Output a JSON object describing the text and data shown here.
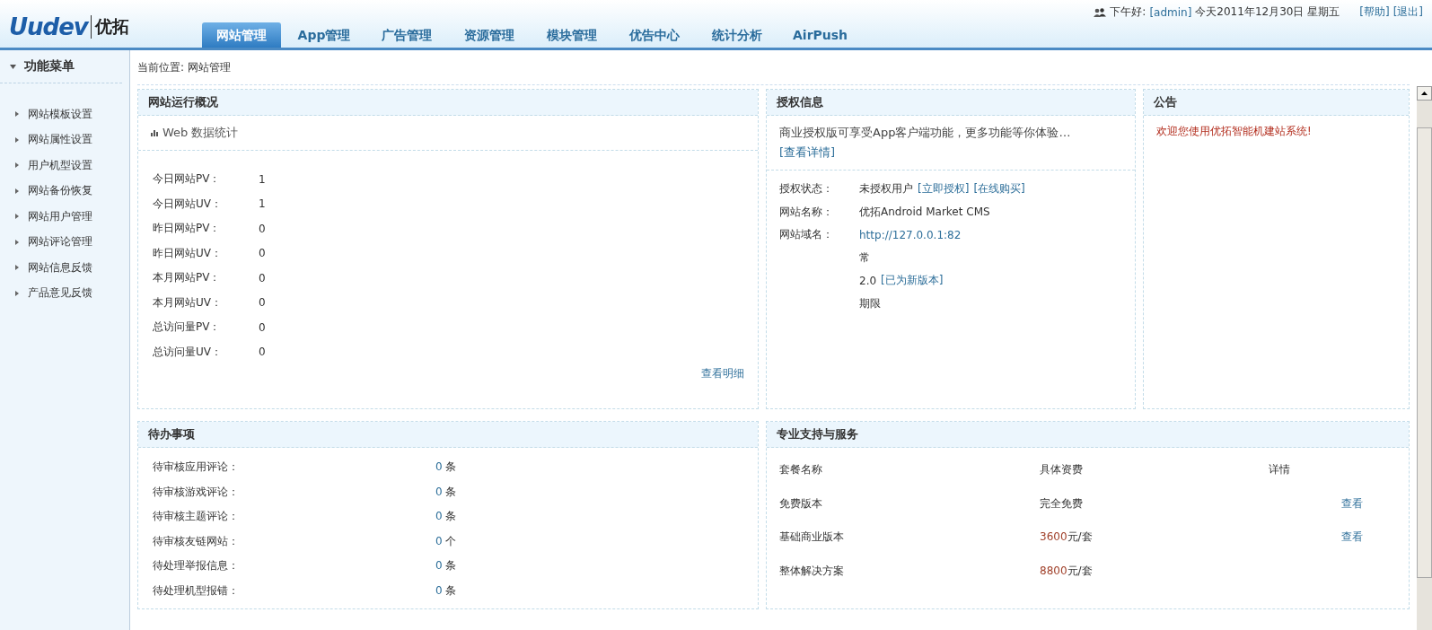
{
  "header": {
    "logo_text": "Uudev",
    "logo_brand": "优拓",
    "greeting": "下午好:",
    "user": "[admin]",
    "date": "今天2011年12月30日 星期五",
    "links": [
      "[帮助]",
      "[退出]"
    ]
  },
  "tabs": [
    {
      "label": "网站管理",
      "selected": true
    },
    {
      "label": "App管理",
      "selected": false
    },
    {
      "label": "广告管理",
      "selected": false
    },
    {
      "label": "资源管理",
      "selected": false
    },
    {
      "label": "模块管理",
      "selected": false
    },
    {
      "label": "优告中心",
      "selected": false
    },
    {
      "label": "统计分析",
      "selected": false
    },
    {
      "label": "AirPush",
      "selected": false
    }
  ],
  "sidebar": {
    "title": "功能菜单",
    "items": [
      "网站模板设置",
      "网站属性设置",
      "用户机型设置",
      "网站备份恢复",
      "网站用户管理",
      "网站评论管理",
      "网站信息反馈",
      "产品意见反馈"
    ]
  },
  "breadcrumb": "当前位置: 网站管理",
  "overview": {
    "title": "网站运行概况",
    "subtitle": "Web 数据统计",
    "stats": [
      {
        "label": "今日网站PV：",
        "value": "1"
      },
      {
        "label": "今日网站UV：",
        "value": "1"
      },
      {
        "label": "昨日网站PV：",
        "value": "0"
      },
      {
        "label": "昨日网站UV：",
        "value": "0"
      },
      {
        "label": "本月网站PV：",
        "value": "0"
      },
      {
        "label": "本月网站UV：",
        "value": "0"
      },
      {
        "label": "总访问量PV：",
        "value": "0"
      },
      {
        "label": "总访问量UV：",
        "value": "0"
      }
    ],
    "more_link": "查看明细"
  },
  "license": {
    "title": "授权信息",
    "intro": "商业授权版可享受App客户端功能，更多功能等你体验…",
    "intro_link": "[查看详情]",
    "rows": [
      {
        "label": "授权状态：",
        "value": "未授权用户",
        "links": [
          "[立即授权]",
          "[在线购买]"
        ]
      },
      {
        "label": "网站名称：",
        "value": "优拓Android Market CMS",
        "links": []
      },
      {
        "label": "网站域名：",
        "link_value": "http://127.0.0.1:82",
        "links": []
      },
      {
        "value": "常",
        "links": []
      },
      {
        "value": "2.0",
        "links": [
          "[已为新版本]"
        ]
      },
      {
        "value": "期限",
        "links": []
      }
    ]
  },
  "notice": {
    "title": "公告",
    "message": "欢迎您使用优拓智能机建站系统!"
  },
  "todo": {
    "title": "待办事项",
    "items": [
      {
        "label": "待审核应用评论：",
        "count": "0",
        "unit": "条"
      },
      {
        "label": "待审核游戏评论：",
        "count": "0",
        "unit": "条"
      },
      {
        "label": "待审核主题评论：",
        "count": "0",
        "unit": "条"
      },
      {
        "label": "待审核友链网站：",
        "count": "0",
        "unit": "个"
      },
      {
        "label": "待处理举报信息：",
        "count": "0",
        "unit": "条"
      },
      {
        "label": "待处理机型报错：",
        "count": "0",
        "unit": "条"
      }
    ]
  },
  "services": {
    "title": "专业支持与服务",
    "columns": [
      "套餐名称",
      "具体资费",
      "详情"
    ],
    "rows": [
      {
        "name": "免费版本",
        "price": "完全免费",
        "link": "查看"
      },
      {
        "name": "基础商业版本",
        "price_amount": "3600",
        "price_unit": "元/套",
        "link": "查看"
      },
      {
        "name": "整体解决方案",
        "price_amount": "8800",
        "price_unit": "元/套"
      }
    ]
  }
}
